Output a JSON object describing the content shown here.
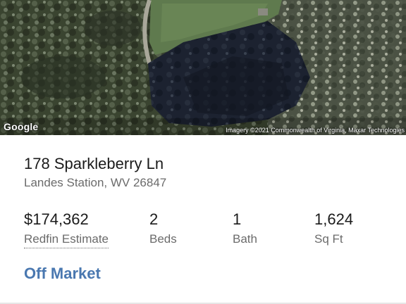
{
  "map": {
    "provider_logo": "Google",
    "attribution": "Imagery ©2021 Commonwealth of Virginia, Maxar Technologies"
  },
  "listing": {
    "address": "178 Sparkleberry Ln",
    "locality": "Landes Station, WV 26847",
    "stats": {
      "price_value": "$174,362",
      "price_label": "Redfin Estimate",
      "beds_value": "2",
      "beds_label": "Beds",
      "bath_value": "1",
      "bath_label": "Bath",
      "sqft_value": "1,624",
      "sqft_label": "Sq Ft"
    },
    "status": "Off Market"
  },
  "colors": {
    "status_accent": "#4a78b0",
    "primary_text": "#1b1b1b",
    "secondary_text": "#6b6b6b"
  }
}
